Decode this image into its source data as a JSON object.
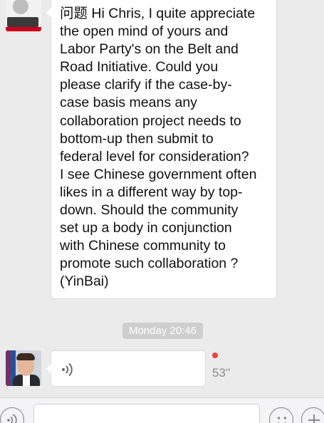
{
  "conversation": {
    "messages": [
      {
        "type": "text",
        "text": "问题 Hi Chris, I quite appreciate\nthe open mind of yours and\nLabor Party's on the Belt and\nRoad Initiative. Could you\nplease clarify if the  case-by-\ncase basis means  any\ncollaboration project needs to\nbottom-up then submit to\nfederal level for consideration?\nI see Chinese government often\nlikes in a different way by top-\ndown.  Should the  community\nset up a body in conjunction\nwith Chinese community to\npromote such collaboration ?\n(YinBai)"
      },
      {
        "type": "timestamp",
        "label": "Monday 20:46"
      },
      {
        "type": "voice",
        "duration_label": "53''",
        "unread": true
      }
    ]
  },
  "input_bar": {
    "text_value": "",
    "voice_icon": "voice-toggle-icon",
    "emoji_icon": "emoji-icon",
    "plus_icon": "plus-icon"
  },
  "colors": {
    "background": "#ebebeb",
    "bubble": "#ffffff",
    "timestamp_pill": "#cecece",
    "unread_dot": "#e64340"
  }
}
